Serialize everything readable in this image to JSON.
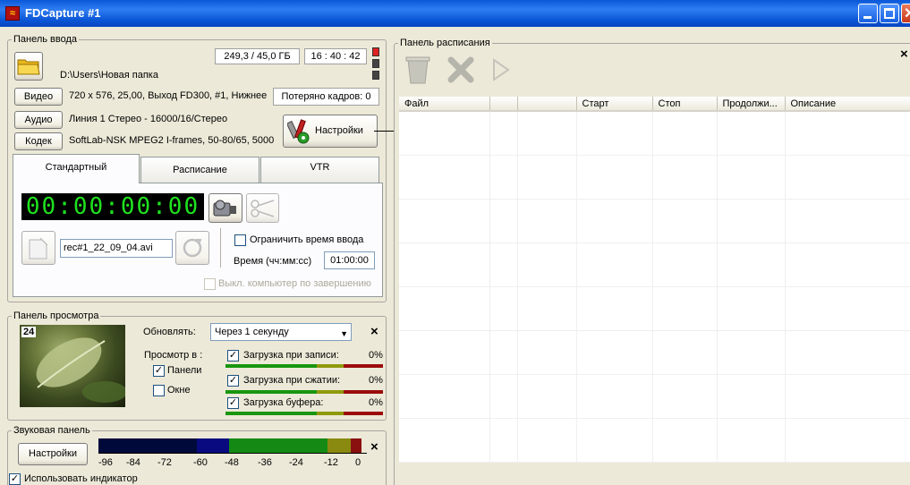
{
  "window": {
    "title": "FDCapture #1",
    "app_icon_glyph": "≈"
  },
  "input_panel": {
    "legend": "Панель ввода",
    "folder_path": "D:\\Users\\Новая папка",
    "disk_space": "249,3 / 45,0 ГБ",
    "clock": "16 : 40 : 42",
    "video": {
      "label": "Видео",
      "value": "720 x 576, 25,00, Выход FD300, #1, Нижнее"
    },
    "lost_frames": "Потеряно кадров: 0",
    "audio": {
      "label": "Аудио",
      "value": "Линия 1 Стерео - 16000/16/Стерео"
    },
    "codec": {
      "label": "Кодек",
      "value": "SoftLab-NSK MPEG2 I-frames, 50-80/65, 5000"
    },
    "settings_button": "Настройки",
    "callout": "1",
    "tabs": [
      "Стандартный",
      "Расписание",
      "VTR"
    ],
    "timecode": "00:00:00:00",
    "filename": "rec#1_22_09_04.avi",
    "limit_time_label": "Ограничить время ввода",
    "limit_time_checked": false,
    "time_label": "Время (чч:мм:сс)",
    "time_value": "01:00:00",
    "shutdown_label": "Выкл. компьютер по завершению",
    "shutdown_checked": false
  },
  "preview_panel": {
    "legend": "Панель просмотра",
    "frame_counter": "24",
    "update_label": "Обновлять:",
    "update_value": "Через 1 секунду",
    "preview_in_label": "Просмотр в :",
    "option_panels": "Панели",
    "option_panels_checked": true,
    "option_window": "Окне",
    "option_window_checked": false,
    "close_glyph": "×",
    "loads": [
      {
        "label": "Загрузка при записи:",
        "value": "0%",
        "checked": true
      },
      {
        "label": "Загрузка при сжатии:",
        "value": "0%",
        "checked": true
      },
      {
        "label": "Загрузка буфера:",
        "value": "0%",
        "checked": true
      }
    ]
  },
  "audio_panel": {
    "legend": "Звуковая панель",
    "settings_button": "Настройки",
    "scale": [
      "-96",
      "-84",
      "-72",
      "-60",
      "-48",
      "-36",
      "-24",
      "-12",
      "0"
    ],
    "use_indicator": "Использовать индикатор",
    "use_indicator_checked": true,
    "close_glyph": "×"
  },
  "schedule_panel": {
    "legend": "Панель расписания",
    "close_glyph": "×",
    "columns": [
      "Файл",
      "",
      "",
      "Старт",
      "Стоп",
      "Продолжи...",
      "Описание"
    ]
  },
  "colors": {
    "title_blue": "#0a58d8",
    "lcd_green": "#1fe21f",
    "meter_green": "#18960f",
    "meter_red": "#9b0c0c"
  }
}
